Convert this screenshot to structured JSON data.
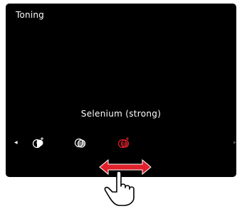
{
  "screen": {
    "title": "Toning",
    "selected_label": "Selenium (strong)"
  },
  "options": [
    {
      "name": "toning-weak-icon",
      "selected": false
    },
    {
      "name": "toning-medium-icon",
      "selected": false
    },
    {
      "name": "toning-strong-icon",
      "selected": true
    }
  ],
  "colors": {
    "screen_background": "#000000",
    "text": "#ffffff",
    "selected_accent": "#e0202a",
    "icon_default": "#ffffff",
    "gesture_arrow": "#e0202a"
  },
  "icons": {
    "left": "chevron-left-icon",
    "right": "chevron-right-icon",
    "gesture": "swipe-horizontal-hand-icon"
  }
}
